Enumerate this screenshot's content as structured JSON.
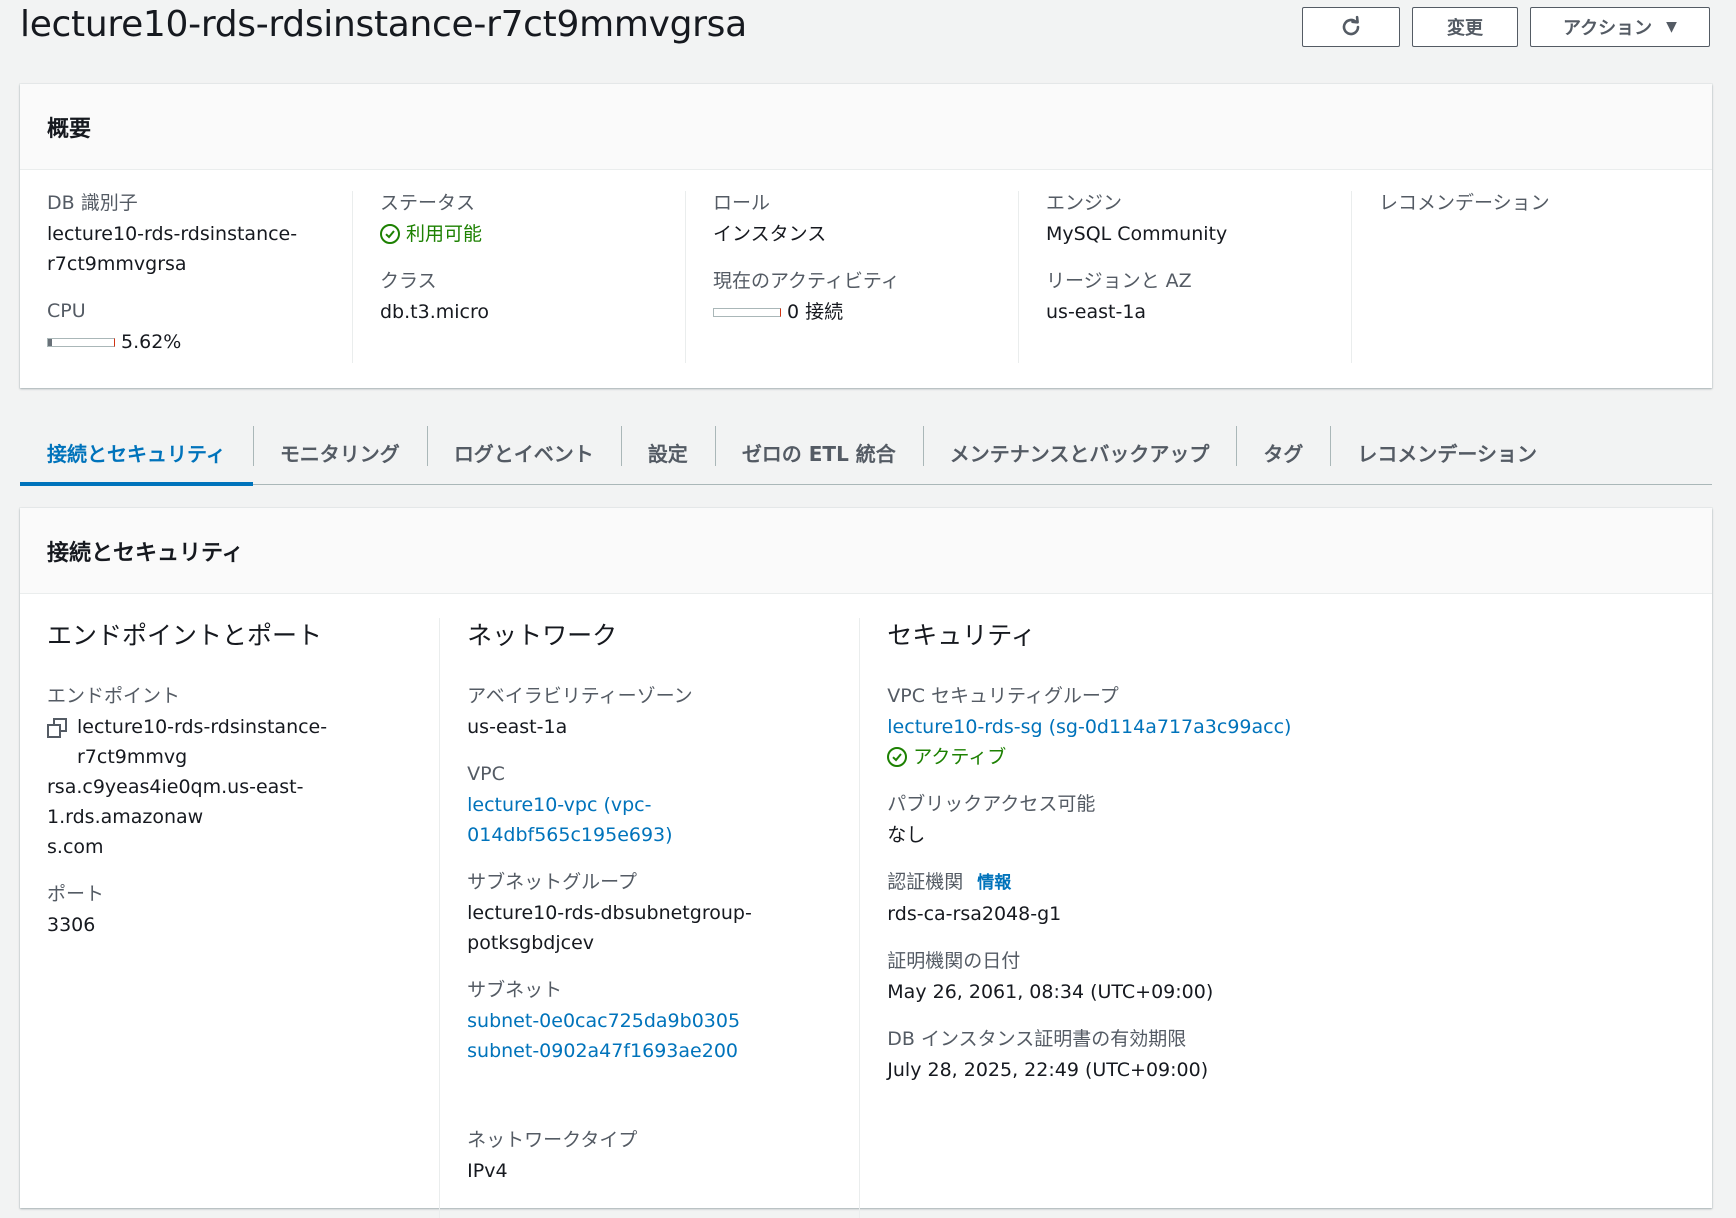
{
  "page": {
    "title": "lecture10-rds-rdsinstance-r7ct9mmvgrsa",
    "buttons": {
      "refresh_icon": "refresh-icon",
      "modify": "変更",
      "actions": "アクション",
      "actions_caret": "▼"
    }
  },
  "summary": {
    "heading": "概要",
    "db_identifier": {
      "label": "DB 識別子",
      "value_line1": "lecture10-rds-rdsinstance-",
      "value_line2": "r7ct9mmvgrsa"
    },
    "cpu": {
      "label": "CPU",
      "value": "5.62%",
      "fraction": 0.0562
    },
    "status": {
      "label": "ステータス",
      "value": "利用可能"
    },
    "class": {
      "label": "クラス",
      "value": "db.t3.micro"
    },
    "role": {
      "label": "ロール",
      "value": "インスタンス"
    },
    "activity": {
      "label": "現在のアクティビティ",
      "value": "0 接続",
      "fraction": 0
    },
    "engine": {
      "label": "エンジン",
      "value": "MySQL Community"
    },
    "region": {
      "label": "リージョンと AZ",
      "value": "us-east-1a"
    },
    "recommendation": {
      "label": "レコメンデーション"
    }
  },
  "tabs": [
    {
      "label": "接続とセキュリティ",
      "active": true
    },
    {
      "label": "モニタリング"
    },
    {
      "label": "ログとイベント"
    },
    {
      "label": "設定"
    },
    {
      "label": "ゼロの ETL 統合"
    },
    {
      "label": "メンテナンスとバックアップ"
    },
    {
      "label": "タグ"
    },
    {
      "label": "レコメンデーション"
    }
  ],
  "connectivity": {
    "heading": "接続とセキュリティ",
    "endpoint_port": {
      "title": "エンドポイントとポート",
      "endpoint_label": "エンドポイント",
      "endpoint_line1": "lecture10-rds-rdsinstance-r7ct9mmvg",
      "endpoint_line2": "rsa.c9yeas4ie0qm.us-east-1.rds.amazonaw",
      "endpoint_line3": "s.com",
      "port_label": "ポート",
      "port_value": "3306"
    },
    "network": {
      "title": "ネットワーク",
      "az_label": "アベイラビリティーゾーン",
      "az_value": "us-east-1a",
      "vpc_label": "VPC",
      "vpc_value": "lecture10-vpc (vpc-014dbf565c195e693)",
      "subnet_group_label": "サブネットグループ",
      "subnet_group_line1": "lecture10-rds-dbsubnetgroup-",
      "subnet_group_line2": "potksgbdjcev",
      "subnets_label": "サブネット",
      "subnet1": "subnet-0e0cac725da9b0305",
      "subnet2": "subnet-0902a47f1693ae200",
      "network_type_label": "ネットワークタイプ",
      "network_type_value": "IPv4"
    },
    "security": {
      "title": "セキュリティ",
      "sg_label": "VPC セキュリティグループ",
      "sg_value": "lecture10-rds-sg (sg-0d114a717a3c99acc)",
      "sg_status": "アクティブ",
      "public_label": "パブリックアクセス可能",
      "public_value": "なし",
      "ca_label": "認証機関",
      "ca_info": "情報",
      "ca_value": "rds-ca-rsa2048-g1",
      "ca_date_label": "証明機関の日付",
      "ca_date_value": "May 26, 2061, 08:34 (UTC+09:00)",
      "cert_expiry_label": "DB インスタンス証明書の有効期限",
      "cert_expiry_value": "July 28, 2025, 22:49 (UTC+09:00)"
    }
  },
  "colors": {
    "link": "#0073bb",
    "success": "#1d8102",
    "text": "#16191f",
    "label": "#545b64"
  }
}
